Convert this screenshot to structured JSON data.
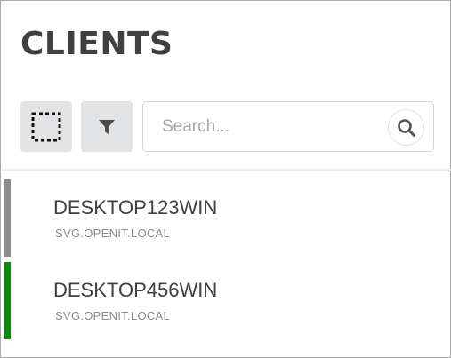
{
  "header": {
    "title": "CLIENTS"
  },
  "toolbar": {
    "select_icon": "selection-marquee-icon",
    "filter_icon": "filter-funnel-icon"
  },
  "search": {
    "placeholder": "Search...",
    "value": "",
    "icon": "magnifier-icon"
  },
  "colors": {
    "status_gray": "#8c8c8c",
    "status_green": "#0a8a0a"
  },
  "clients": [
    {
      "name": "DESKTOP123WIN",
      "domain": "SVG.OPENIT.LOCAL",
      "status_color": "#8c8c8c"
    },
    {
      "name": "DESKTOP456WIN",
      "domain": "SVG.OPENIT.LOCAL",
      "status_color": "#0a8a0a"
    }
  ]
}
